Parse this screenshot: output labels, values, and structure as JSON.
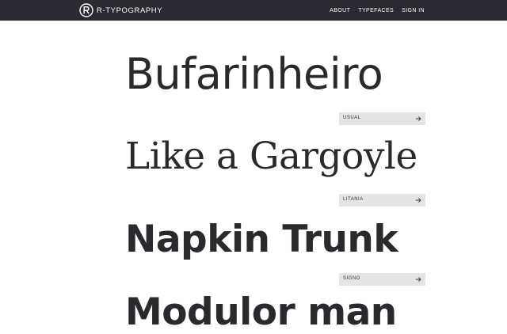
{
  "header": {
    "brand": "R-TYPOGRAPHY",
    "logo_icon": "r-circle-logo-icon",
    "nav": [
      "ABOUT",
      "TYPEFACES",
      "SIGN IN"
    ]
  },
  "specimens": [
    {
      "sample": "Bufarinheiro",
      "typeface": "USUAL",
      "icon": "arrow-right-icon"
    },
    {
      "sample": "Like a Gargoyle",
      "typeface": "LITANIA",
      "icon": "arrow-right-icon"
    },
    {
      "sample": "Napkin Trunk",
      "typeface": "SIGNO",
      "icon": "arrow-right-icon"
    },
    {
      "sample": "Modulor man"
    }
  ],
  "colors": {
    "topbar": "#2a2a30",
    "tag_background": "#e4e4e4",
    "text": "#2a2a2e"
  }
}
